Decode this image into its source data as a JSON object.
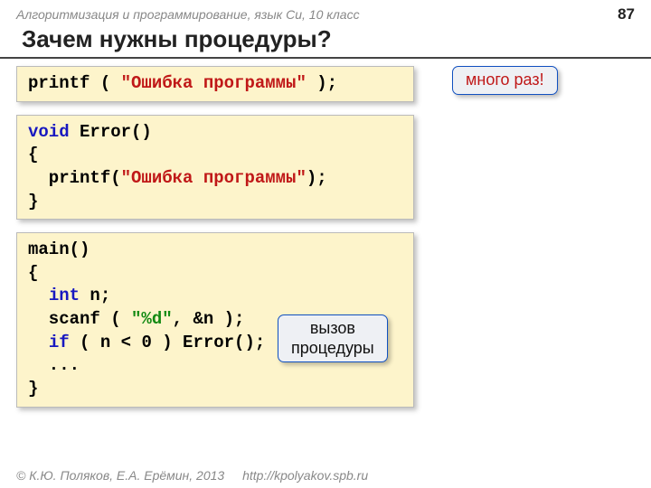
{
  "header": {
    "course": "Алгоритмизация и программирование, язык Си, 10 класс",
    "page": "87"
  },
  "title": "Зачем нужны процедуры?",
  "code1": {
    "t1": "printf ( ",
    "t2": "\"Ошибка программы\"",
    "t3": " );"
  },
  "callout1": "много раз!",
  "code2": {
    "l1a": "void",
    "l1b": " Error()",
    "l2": "{",
    "l3a": "  printf(",
    "l3b": "\"Ошибка программы\"",
    "l3c": ");",
    "l4": "}"
  },
  "code3": {
    "l1": "main()",
    "l2": "{",
    "l3a": "  ",
    "l3b": "int",
    "l3c": " n;",
    "l4a": "  scanf ( ",
    "l4b": "\"%d\"",
    "l4c": ", &n );",
    "l5a": "  ",
    "l5b": "if",
    "l5c": " ( n < 0 ) Error();",
    "l6": "  ...",
    "l7": "}"
  },
  "callout2_l1": "вызов",
  "callout2_l2": "процедуры",
  "footer": {
    "copyright": "© К.Ю. Поляков, Е.А. Ерёмин, 2013",
    "url": "http://kpolyakov.spb.ru"
  }
}
